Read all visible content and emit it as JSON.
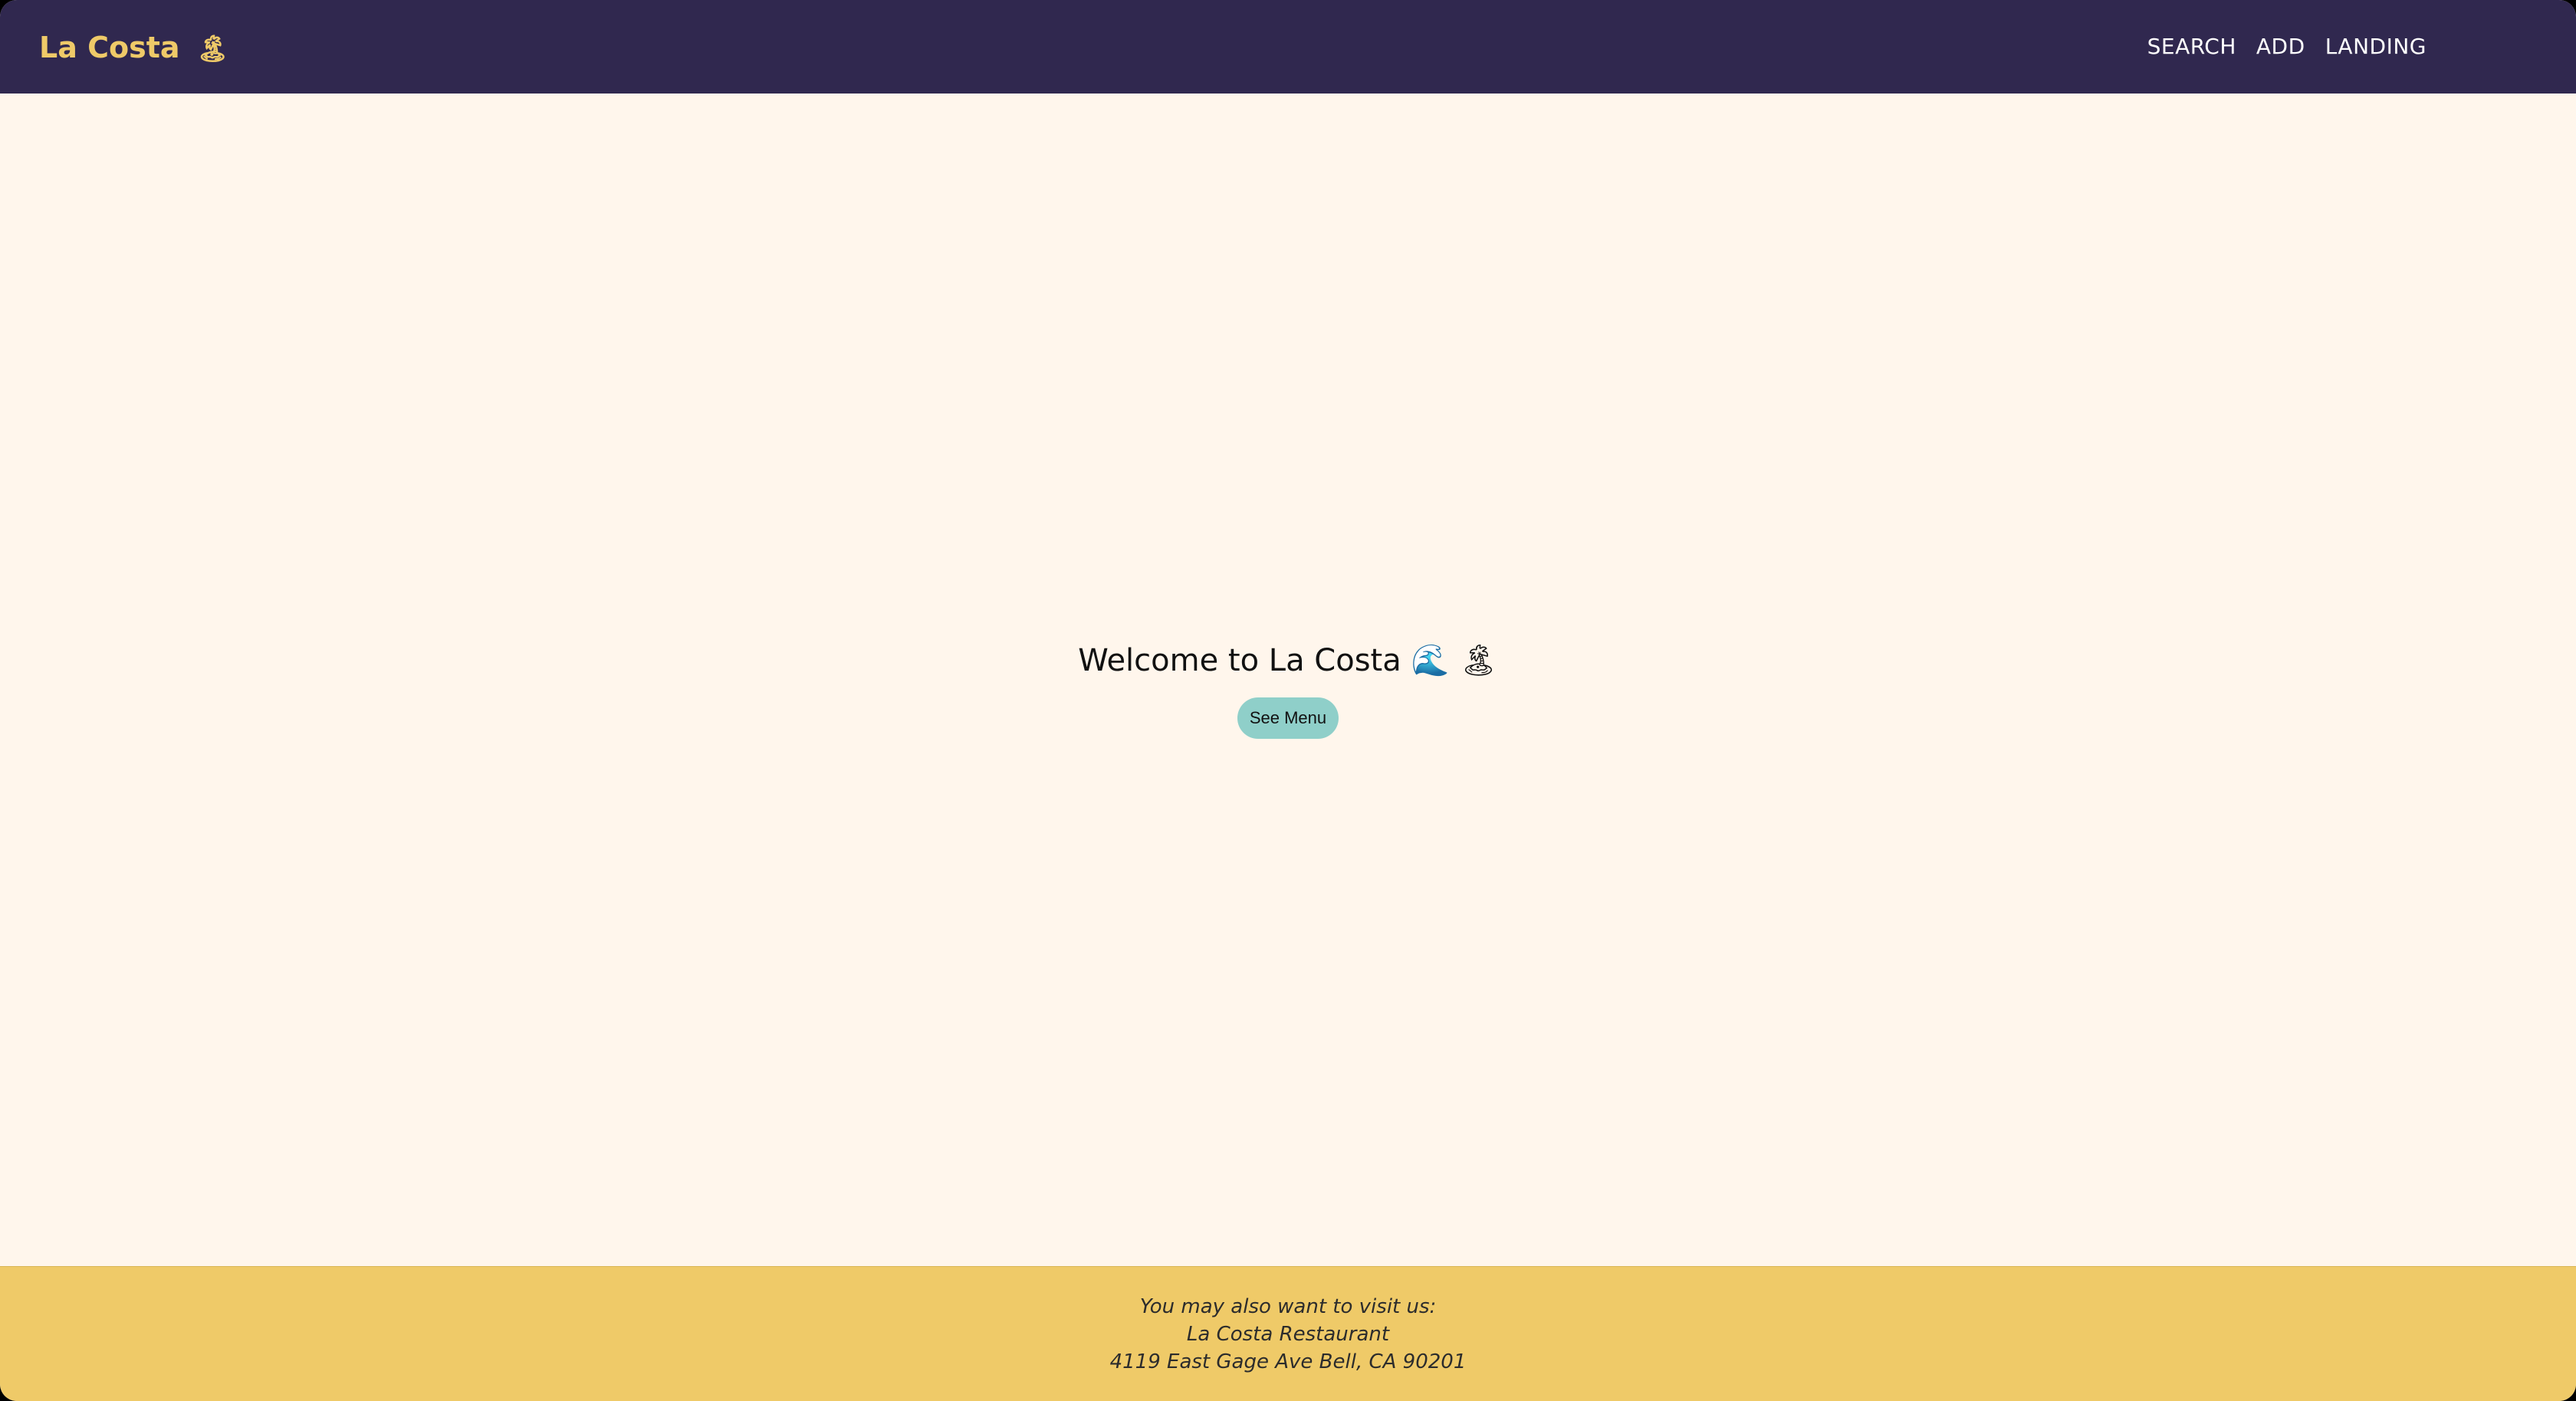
{
  "header": {
    "brand_text": "La Costa",
    "brand_emoji": "🏝",
    "nav_links": [
      {
        "label": "SEARCH"
      },
      {
        "label": "ADD"
      },
      {
        "label": "LANDING"
      }
    ]
  },
  "hero": {
    "title": "Welcome to La Costa 🌊 🏝",
    "button_label": "See Menu"
  },
  "footer": {
    "line1": "You may also want to visit us:",
    "line2": "La Costa Restaurant",
    "line3": "4119 East Gage Ave Bell, CA 90201"
  },
  "colors": {
    "navbar_bg": "#30284f",
    "brand": "#efca68",
    "page_bg": "#fff6ec",
    "button_bg": "#8fcfc9",
    "footer_bg": "#efca68"
  }
}
